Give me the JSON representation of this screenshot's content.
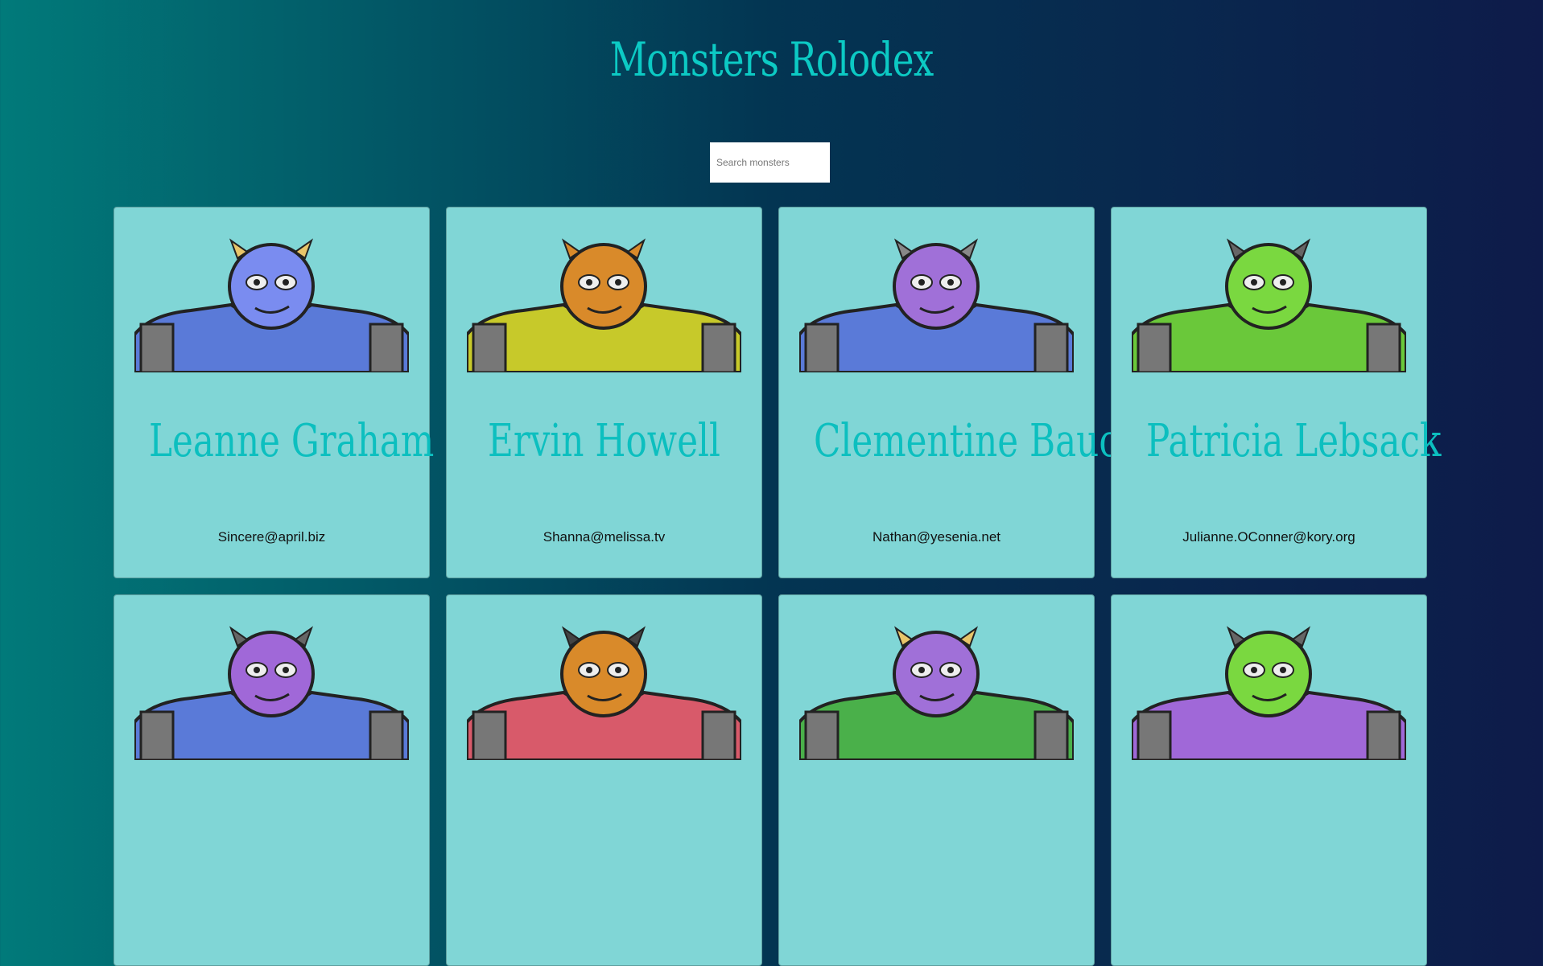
{
  "header": {
    "title": "Monsters Rolodex"
  },
  "search": {
    "placeholder": "Search monsters",
    "value": ""
  },
  "monsters": [
    {
      "name": "Leanne Graham",
      "email": "Sincere@april.biz",
      "skin": "#7a8cf0",
      "body": "#5a7ad8",
      "horn": "#e8c56a"
    },
    {
      "name": "Ervin Howell",
      "email": "Shanna@melissa.tv",
      "skin": "#d98a2a",
      "body": "#c7c92a",
      "horn": "#d98a2a"
    },
    {
      "name": "Clementine Bauch",
      "email": "Nathan@yesenia.net",
      "skin": "#a070d8",
      "body": "#5a7ad8",
      "horn": "#888888"
    },
    {
      "name": "Patricia Lebsack",
      "email": "Julianne.OConner@kory.org",
      "skin": "#7ad840",
      "body": "#6ac83a",
      "horn": "#666666"
    },
    {
      "name": "",
      "email": "",
      "skin": "#a068d8",
      "body": "#5a7ad8",
      "horn": "#666666"
    },
    {
      "name": "",
      "email": "",
      "skin": "#d98a2a",
      "body": "#d85a6a",
      "horn": "#444444"
    },
    {
      "name": "",
      "email": "",
      "skin": "#a070d8",
      "body": "#4ab04a",
      "horn": "#e8c56a"
    },
    {
      "name": "",
      "email": "",
      "skin": "#7ad840",
      "body": "#a068d8",
      "horn": "#666666"
    }
  ]
}
